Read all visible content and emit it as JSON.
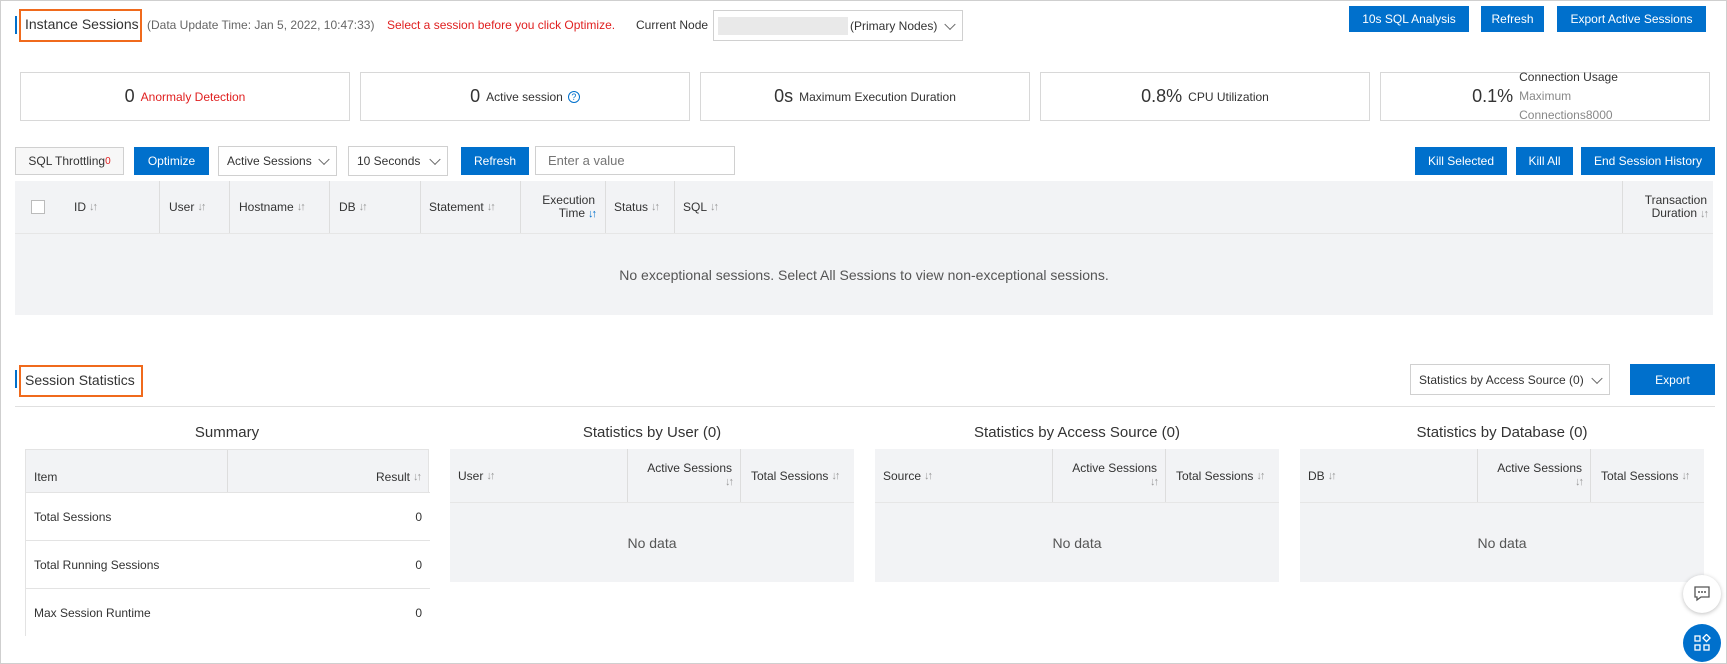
{
  "instance": {
    "title": "Instance Sessions",
    "update_time": "(Data Update Time: Jan 5, 2022, 10:47:33)",
    "hint": "Select a session before you click Optimize.",
    "node_label": "Current Node",
    "node_value": "(Primary Nodes)",
    "btn_sql_analysis": "10s SQL Analysis",
    "btn_refresh": "Refresh",
    "btn_export_active": "Export Active Sessions"
  },
  "cards": [
    {
      "value": "0",
      "label": "Anormaly Detection"
    },
    {
      "value": "0",
      "label": "Active session"
    },
    {
      "value": "0s",
      "label": "Maximum Execution Duration"
    },
    {
      "value": "0.8%",
      "label": "CPU Utilization"
    },
    {
      "value": "0.1%",
      "label_line1": "Connection Usage",
      "label_line2": "Maximum",
      "label_line3": "Connections8000"
    }
  ],
  "toolbar": {
    "throttling": "SQL Throttling",
    "throttling_count": "0",
    "optimize": "Optimize",
    "session_filter": "Active Sessions",
    "interval": "10 Seconds",
    "refresh": "Refresh",
    "search_placeholder": "Enter a value",
    "kill_selected": "Kill Selected",
    "kill_all": "Kill All",
    "end_history": "End Session History"
  },
  "sessions_table": {
    "columns": [
      "ID",
      "User",
      "Hostname",
      "DB",
      "Statement",
      "Execution",
      "Time",
      "Status",
      "SQL",
      "Transaction",
      "Duration"
    ],
    "empty_message": "No exceptional sessions. Select All Sessions to view non-exceptional sessions."
  },
  "statistics": {
    "title": "Session Statistics",
    "source_select": "Statistics by Access Source (0)",
    "export": "Export",
    "summary": {
      "title": "Summary",
      "col_item": "Item",
      "col_result": "Result",
      "rows": [
        {
          "item": "Total Sessions",
          "result": "0"
        },
        {
          "item": "Total Running Sessions",
          "result": "0"
        },
        {
          "item": "Max Session Runtime",
          "result": "0"
        }
      ]
    },
    "by_user": {
      "title": "Statistics by User (0)",
      "c1": "User",
      "c2": "Active Sessions",
      "c3": "Total Sessions",
      "empty": "No data"
    },
    "by_source": {
      "title": "Statistics by Access Source (0)",
      "c1": "Source",
      "c2": "Active Sessions",
      "c3": "Total Sessions",
      "empty": "No data"
    },
    "by_db": {
      "title": "Statistics by Database (0)",
      "c1": "DB",
      "c2": "Active Sessions",
      "c3": "Total Sessions",
      "empty": "No data"
    }
  },
  "colors": {
    "primary": "#0070cc",
    "highlight": "#f06a1c",
    "warning": "#e02020"
  }
}
